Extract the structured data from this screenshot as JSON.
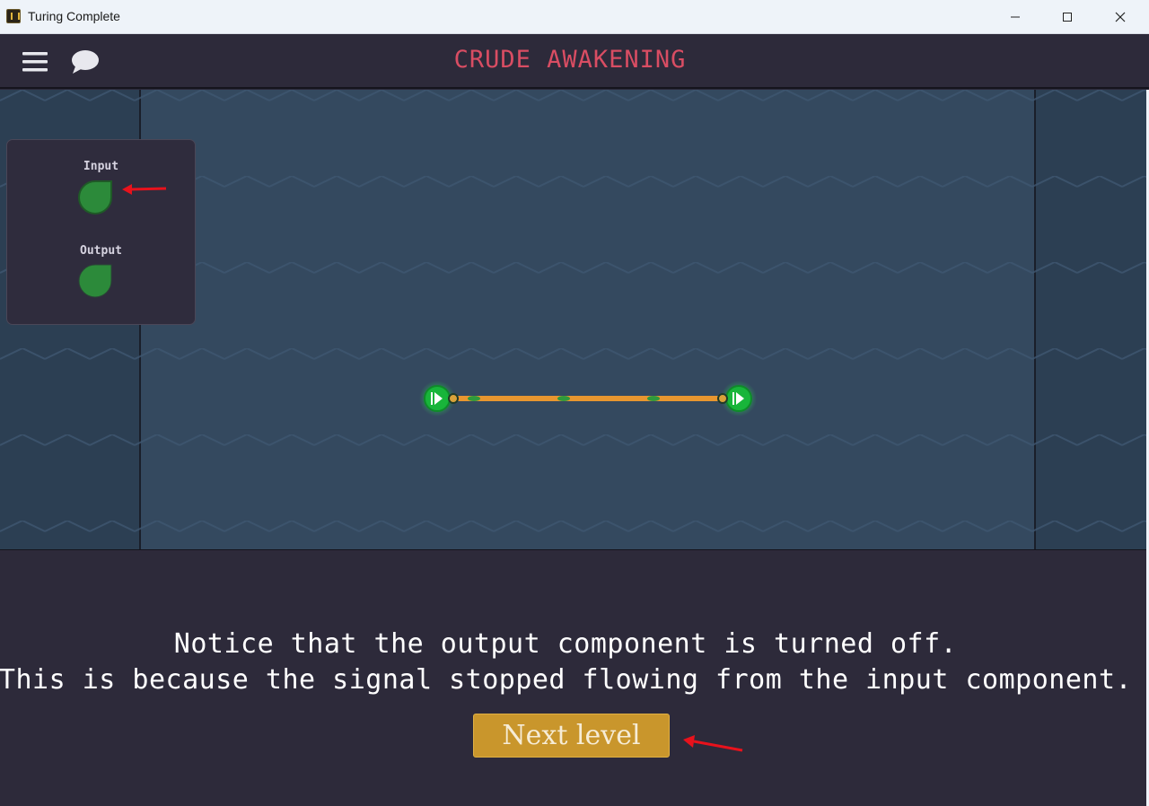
{
  "window": {
    "title": "Turing Complete",
    "controls": [
      "minimize-icon",
      "maximize-icon",
      "close-icon"
    ]
  },
  "header": {
    "level_title": "CRUDE AWAKENING",
    "icons": [
      "menu-icon",
      "chat-icon"
    ]
  },
  "palette": {
    "items": [
      {
        "label": "Input",
        "icon": "input-component-icon"
      },
      {
        "label": "Output",
        "icon": "output-component-icon"
      }
    ]
  },
  "circuit": {
    "input_node": "input-pin-icon",
    "output_node": "output-pin-icon",
    "wire_color": "#e8962f",
    "pin_color": "#18b53a"
  },
  "dialog": {
    "line1": "Notice that the output component is turned off.",
    "line2": "This is because the signal stopped flowing from the input component.",
    "next_button": "Next level"
  },
  "colors": {
    "title": "#d94d63",
    "button": "#c9962c",
    "board": "#34495f",
    "annotation_arrow": "#e8121c"
  }
}
